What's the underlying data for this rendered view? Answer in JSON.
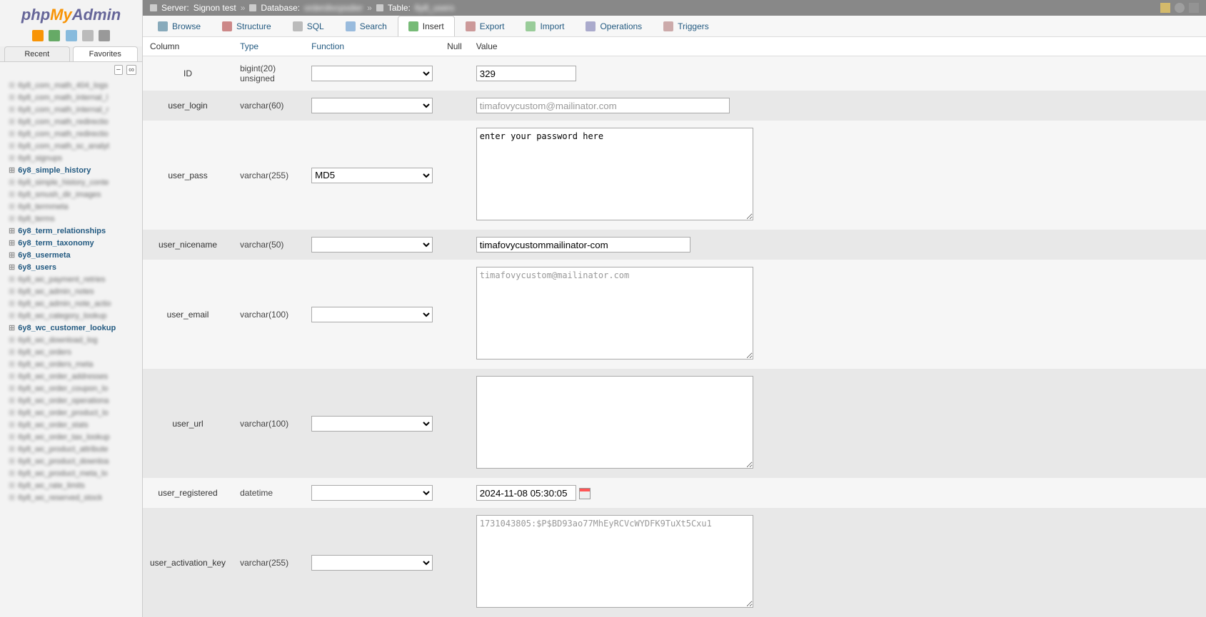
{
  "logo": {
    "part1": "php",
    "part2": "My",
    "part3": "Admin"
  },
  "sidebar": {
    "tabs": {
      "recent": "Recent",
      "favorites": "Favorites"
    },
    "collapse": {
      "minus": "−",
      "link": "∞"
    },
    "tree": [
      {
        "label": "6y8_com_math_404_logs",
        "clear": false
      },
      {
        "label": "6y8_com_math_internal_l",
        "clear": false
      },
      {
        "label": "6y8_com_math_internal_r",
        "clear": false
      },
      {
        "label": "6y8_com_math_redirectio",
        "clear": false
      },
      {
        "label": "6y8_com_math_redirectio",
        "clear": false
      },
      {
        "label": "6y8_com_math_sc_analyt",
        "clear": false
      },
      {
        "label": "6y8_signups",
        "clear": false
      },
      {
        "label": "6y8_simple_history",
        "clear": true
      },
      {
        "label": "6y8_simple_history_conte",
        "clear": false
      },
      {
        "label": "6y8_smush_dir_images",
        "clear": false
      },
      {
        "label": "6y8_termmeta",
        "clear": false
      },
      {
        "label": "6y8_terms",
        "clear": false
      },
      {
        "label": "6y8_term_relationships",
        "clear": true
      },
      {
        "label": "6y8_term_taxonomy",
        "clear": true
      },
      {
        "label": "6y8_usermeta",
        "clear": true
      },
      {
        "label": "6y8_users",
        "clear": true
      },
      {
        "label": "6y8_wc_payment_retries",
        "clear": false
      },
      {
        "label": "6y8_wc_admin_notes",
        "clear": false
      },
      {
        "label": "6y8_wc_admin_note_actio",
        "clear": false
      },
      {
        "label": "6y8_wc_category_lookup",
        "clear": false
      },
      {
        "label": "6y8_wc_customer_lookup",
        "clear": true
      },
      {
        "label": "6y8_wc_download_log",
        "clear": false
      },
      {
        "label": "6y8_wc_orders",
        "clear": false
      },
      {
        "label": "6y8_wc_orders_meta",
        "clear": false
      },
      {
        "label": "6y8_wc_order_addresses",
        "clear": false
      },
      {
        "label": "6y8_wc_order_coupon_lo",
        "clear": false
      },
      {
        "label": "6y8_wc_order_operationa",
        "clear": false
      },
      {
        "label": "6y8_wc_order_product_lo",
        "clear": false
      },
      {
        "label": "6y8_wc_order_stats",
        "clear": false
      },
      {
        "label": "6y8_wc_order_tax_lookup",
        "clear": false
      },
      {
        "label": "6y8_wc_product_attribute",
        "clear": false
      },
      {
        "label": "6y8_wc_product_downloa",
        "clear": false
      },
      {
        "label": "6y8_wc_product_meta_lo",
        "clear": false
      },
      {
        "label": "6y8_wc_rate_limits",
        "clear": false
      },
      {
        "label": "6y8_wc_reserved_stock",
        "clear": false
      }
    ]
  },
  "breadcrumb": {
    "server_label": "Server:",
    "server_name": "Signon test",
    "db_label": "Database:",
    "db_name": "orderdivcpsdier",
    "table_label": "Table:",
    "table_name": "6y8_users",
    "sep": "»"
  },
  "tabs": {
    "browse": "Browse",
    "structure": "Structure",
    "sql": "SQL",
    "search": "Search",
    "insert": "Insert",
    "export": "Export",
    "import": "Import",
    "operations": "Operations",
    "triggers": "Triggers"
  },
  "headers": {
    "column": "Column",
    "type": "Type",
    "function": "Function",
    "null": "Null",
    "value": "Value"
  },
  "rows": [
    {
      "column": "ID",
      "type": "bigint(20) unsigned",
      "function": "",
      "value": "329",
      "input": "short"
    },
    {
      "column": "user_login",
      "type": "varchar(60)",
      "function": "",
      "value": "timafovycustom@mailinator.com",
      "input": "long",
      "blurred": true
    },
    {
      "column": "user_pass",
      "type": "varchar(255)",
      "function": "MD5",
      "value": "enter your password here",
      "input": "textarea"
    },
    {
      "column": "user_nicename",
      "type": "varchar(50)",
      "function": "",
      "value": "timafovycustommailinator-com",
      "input": "med"
    },
    {
      "column": "user_email",
      "type": "varchar(100)",
      "function": "",
      "value": "timafovycustom@mailinator.com",
      "input": "textarea",
      "blurred": true
    },
    {
      "column": "user_url",
      "type": "varchar(100)",
      "function": "",
      "value": "",
      "input": "textarea"
    },
    {
      "column": "user_registered",
      "type": "datetime",
      "function": "",
      "value": "2024-11-08 05:30:05",
      "input": "short",
      "calendar": true
    },
    {
      "column": "user_activation_key",
      "type": "varchar(255)",
      "function": "",
      "value": "1731043805:$P$BD93ao77MhEyRCVcWYDFK9TuXt5Cxu1",
      "input": "textarea",
      "blurred": true
    }
  ]
}
